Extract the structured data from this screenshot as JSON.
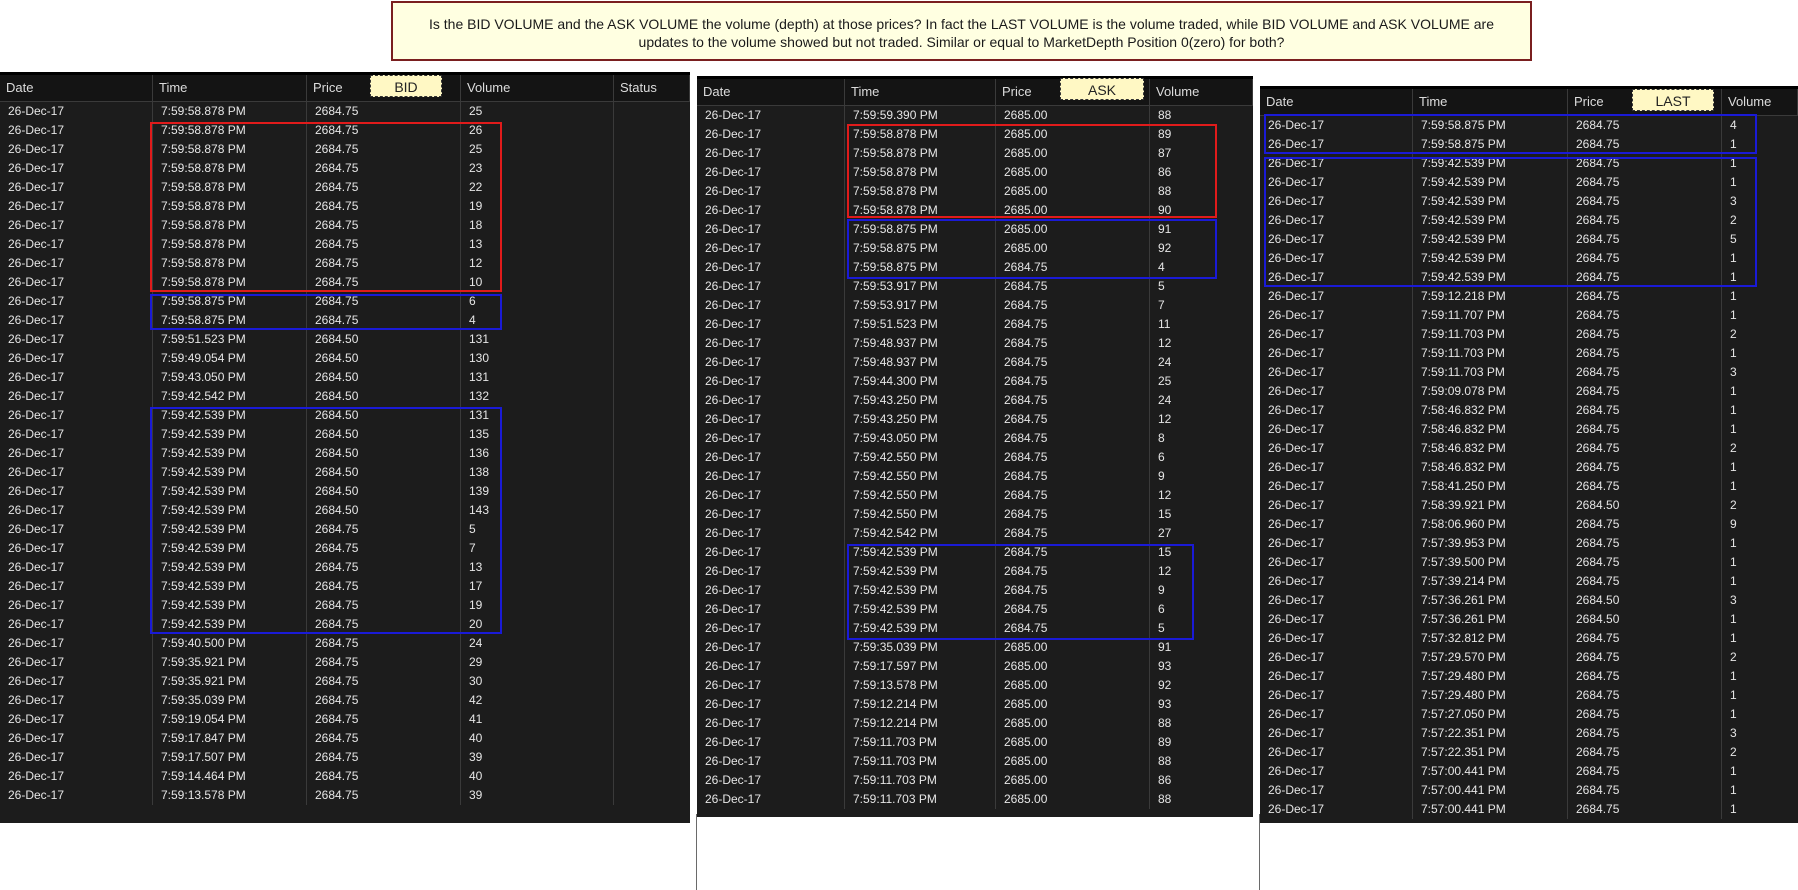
{
  "note": {
    "text": "Is the BID VOLUME and the ASK VOLUME the volume (depth) at those prices? In fact the LAST VOLUME is the volume traded, while BID VOLUME and ASK VOLUME are updates to the volume showed but not traded. Similar or equal to MarketDepth Position 0(zero) for both?"
  },
  "bid": {
    "tag": "BID",
    "headers": [
      "Date",
      "Time",
      "Price",
      "Volume",
      "Status"
    ],
    "rows": [
      [
        "26-Dec-17",
        "7:59:58.878 PM",
        "2684.75",
        "25"
      ],
      [
        "26-Dec-17",
        "7:59:58.878 PM",
        "2684.75",
        "26"
      ],
      [
        "26-Dec-17",
        "7:59:58.878 PM",
        "2684.75",
        "25"
      ],
      [
        "26-Dec-17",
        "7:59:58.878 PM",
        "2684.75",
        "23"
      ],
      [
        "26-Dec-17",
        "7:59:58.878 PM",
        "2684.75",
        "22"
      ],
      [
        "26-Dec-17",
        "7:59:58.878 PM",
        "2684.75",
        "19"
      ],
      [
        "26-Dec-17",
        "7:59:58.878 PM",
        "2684.75",
        "18"
      ],
      [
        "26-Dec-17",
        "7:59:58.878 PM",
        "2684.75",
        "13"
      ],
      [
        "26-Dec-17",
        "7:59:58.878 PM",
        "2684.75",
        "12"
      ],
      [
        "26-Dec-17",
        "7:59:58.878 PM",
        "2684.75",
        "10"
      ],
      [
        "26-Dec-17",
        "7:59:58.875 PM",
        "2684.75",
        "6"
      ],
      [
        "26-Dec-17",
        "7:59:58.875 PM",
        "2684.75",
        "4"
      ],
      [
        "26-Dec-17",
        "7:59:51.523 PM",
        "2684.50",
        "131"
      ],
      [
        "26-Dec-17",
        "7:59:49.054 PM",
        "2684.50",
        "130"
      ],
      [
        "26-Dec-17",
        "7:59:43.050 PM",
        "2684.50",
        "131"
      ],
      [
        "26-Dec-17",
        "7:59:42.542 PM",
        "2684.50",
        "132"
      ],
      [
        "26-Dec-17",
        "7:59:42.539 PM",
        "2684.50",
        "131"
      ],
      [
        "26-Dec-17",
        "7:59:42.539 PM",
        "2684.50",
        "135"
      ],
      [
        "26-Dec-17",
        "7:59:42.539 PM",
        "2684.50",
        "136"
      ],
      [
        "26-Dec-17",
        "7:59:42.539 PM",
        "2684.50",
        "138"
      ],
      [
        "26-Dec-17",
        "7:59:42.539 PM",
        "2684.50",
        "139"
      ],
      [
        "26-Dec-17",
        "7:59:42.539 PM",
        "2684.50",
        "143"
      ],
      [
        "26-Dec-17",
        "7:59:42.539 PM",
        "2684.75",
        "5"
      ],
      [
        "26-Dec-17",
        "7:59:42.539 PM",
        "2684.75",
        "7"
      ],
      [
        "26-Dec-17",
        "7:59:42.539 PM",
        "2684.75",
        "13"
      ],
      [
        "26-Dec-17",
        "7:59:42.539 PM",
        "2684.75",
        "17"
      ],
      [
        "26-Dec-17",
        "7:59:42.539 PM",
        "2684.75",
        "19"
      ],
      [
        "26-Dec-17",
        "7:59:42.539 PM",
        "2684.75",
        "20"
      ],
      [
        "26-Dec-17",
        "7:59:40.500 PM",
        "2684.75",
        "24"
      ],
      [
        "26-Dec-17",
        "7:59:35.921 PM",
        "2684.75",
        "29"
      ],
      [
        "26-Dec-17",
        "7:59:35.921 PM",
        "2684.75",
        "30"
      ],
      [
        "26-Dec-17",
        "7:59:35.039 PM",
        "2684.75",
        "42"
      ],
      [
        "26-Dec-17",
        "7:59:19.054 PM",
        "2684.75",
        "41"
      ],
      [
        "26-Dec-17",
        "7:59:17.847 PM",
        "2684.75",
        "40"
      ],
      [
        "26-Dec-17",
        "7:59:17.507 PM",
        "2684.75",
        "39"
      ],
      [
        "26-Dec-17",
        "7:59:14.464 PM",
        "2684.75",
        "40"
      ],
      [
        "26-Dec-17",
        "7:59:13.578 PM",
        "2684.75",
        "39"
      ]
    ]
  },
  "ask": {
    "tag": "ASK",
    "headers": [
      "Date",
      "Time",
      "Price",
      "Volume"
    ],
    "rows": [
      [
        "26-Dec-17",
        "7:59:59.390 PM",
        "2685.00",
        "88"
      ],
      [
        "26-Dec-17",
        "7:59:58.878 PM",
        "2685.00",
        "89"
      ],
      [
        "26-Dec-17",
        "7:59:58.878 PM",
        "2685.00",
        "87"
      ],
      [
        "26-Dec-17",
        "7:59:58.878 PM",
        "2685.00",
        "86"
      ],
      [
        "26-Dec-17",
        "7:59:58.878 PM",
        "2685.00",
        "88"
      ],
      [
        "26-Dec-17",
        "7:59:58.878 PM",
        "2685.00",
        "90"
      ],
      [
        "26-Dec-17",
        "7:59:58.875 PM",
        "2685.00",
        "91"
      ],
      [
        "26-Dec-17",
        "7:59:58.875 PM",
        "2685.00",
        "92"
      ],
      [
        "26-Dec-17",
        "7:59:58.875 PM",
        "2684.75",
        "4"
      ],
      [
        "26-Dec-17",
        "7:59:53.917 PM",
        "2684.75",
        "5"
      ],
      [
        "26-Dec-17",
        "7:59:53.917 PM",
        "2684.75",
        "7"
      ],
      [
        "26-Dec-17",
        "7:59:51.523 PM",
        "2684.75",
        "11"
      ],
      [
        "26-Dec-17",
        "7:59:48.937 PM",
        "2684.75",
        "12"
      ],
      [
        "26-Dec-17",
        "7:59:48.937 PM",
        "2684.75",
        "24"
      ],
      [
        "26-Dec-17",
        "7:59:44.300 PM",
        "2684.75",
        "25"
      ],
      [
        "26-Dec-17",
        "7:59:43.250 PM",
        "2684.75",
        "24"
      ],
      [
        "26-Dec-17",
        "7:59:43.250 PM",
        "2684.75",
        "12"
      ],
      [
        "26-Dec-17",
        "7:59:43.050 PM",
        "2684.75",
        "8"
      ],
      [
        "26-Dec-17",
        "7:59:42.550 PM",
        "2684.75",
        "6"
      ],
      [
        "26-Dec-17",
        "7:59:42.550 PM",
        "2684.75",
        "9"
      ],
      [
        "26-Dec-17",
        "7:59:42.550 PM",
        "2684.75",
        "12"
      ],
      [
        "26-Dec-17",
        "7:59:42.550 PM",
        "2684.75",
        "15"
      ],
      [
        "26-Dec-17",
        "7:59:42.542 PM",
        "2684.75",
        "27"
      ],
      [
        "26-Dec-17",
        "7:59:42.539 PM",
        "2684.75",
        "15"
      ],
      [
        "26-Dec-17",
        "7:59:42.539 PM",
        "2684.75",
        "12"
      ],
      [
        "26-Dec-17",
        "7:59:42.539 PM",
        "2684.75",
        "9"
      ],
      [
        "26-Dec-17",
        "7:59:42.539 PM",
        "2684.75",
        "6"
      ],
      [
        "26-Dec-17",
        "7:59:42.539 PM",
        "2684.75",
        "5"
      ],
      [
        "26-Dec-17",
        "7:59:35.039 PM",
        "2685.00",
        "91"
      ],
      [
        "26-Dec-17",
        "7:59:17.597 PM",
        "2685.00",
        "93"
      ],
      [
        "26-Dec-17",
        "7:59:13.578 PM",
        "2685.00",
        "92"
      ],
      [
        "26-Dec-17",
        "7:59:12.214 PM",
        "2685.00",
        "93"
      ],
      [
        "26-Dec-17",
        "7:59:12.214 PM",
        "2685.00",
        "88"
      ],
      [
        "26-Dec-17",
        "7:59:11.703 PM",
        "2685.00",
        "89"
      ],
      [
        "26-Dec-17",
        "7:59:11.703 PM",
        "2685.00",
        "88"
      ],
      [
        "26-Dec-17",
        "7:59:11.703 PM",
        "2685.00",
        "86"
      ],
      [
        "26-Dec-17",
        "7:59:11.703 PM",
        "2685.00",
        "88"
      ]
    ]
  },
  "last": {
    "tag": "LAST",
    "headers": [
      "Date",
      "Time",
      "Price",
      "Volume"
    ],
    "rows": [
      [
        "26-Dec-17",
        "7:59:58.875 PM",
        "2684.75",
        "4"
      ],
      [
        "26-Dec-17",
        "7:59:58.875 PM",
        "2684.75",
        "1"
      ],
      [
        "26-Dec-17",
        "7:59:42.539 PM",
        "2684.75",
        "1"
      ],
      [
        "26-Dec-17",
        "7:59:42.539 PM",
        "2684.75",
        "1"
      ],
      [
        "26-Dec-17",
        "7:59:42.539 PM",
        "2684.75",
        "3"
      ],
      [
        "26-Dec-17",
        "7:59:42.539 PM",
        "2684.75",
        "2"
      ],
      [
        "26-Dec-17",
        "7:59:42.539 PM",
        "2684.75",
        "5"
      ],
      [
        "26-Dec-17",
        "7:59:42.539 PM",
        "2684.75",
        "1"
      ],
      [
        "26-Dec-17",
        "7:59:42.539 PM",
        "2684.75",
        "1"
      ],
      [
        "26-Dec-17",
        "7:59:12.218 PM",
        "2684.75",
        "1"
      ],
      [
        "26-Dec-17",
        "7:59:11.707 PM",
        "2684.75",
        "1"
      ],
      [
        "26-Dec-17",
        "7:59:11.703 PM",
        "2684.75",
        "2"
      ],
      [
        "26-Dec-17",
        "7:59:11.703 PM",
        "2684.75",
        "1"
      ],
      [
        "26-Dec-17",
        "7:59:11.703 PM",
        "2684.75",
        "3"
      ],
      [
        "26-Dec-17",
        "7:59:09.078 PM",
        "2684.75",
        "1"
      ],
      [
        "26-Dec-17",
        "7:58:46.832 PM",
        "2684.75",
        "1"
      ],
      [
        "26-Dec-17",
        "7:58:46.832 PM",
        "2684.75",
        "1"
      ],
      [
        "26-Dec-17",
        "7:58:46.832 PM",
        "2684.75",
        "2"
      ],
      [
        "26-Dec-17",
        "7:58:46.832 PM",
        "2684.75",
        "1"
      ],
      [
        "26-Dec-17",
        "7:58:41.250 PM",
        "2684.75",
        "1"
      ],
      [
        "26-Dec-17",
        "7:58:39.921 PM",
        "2684.50",
        "2"
      ],
      [
        "26-Dec-17",
        "7:58:06.960 PM",
        "2684.75",
        "9"
      ],
      [
        "26-Dec-17",
        "7:57:39.953 PM",
        "2684.75",
        "1"
      ],
      [
        "26-Dec-17",
        "7:57:39.500 PM",
        "2684.75",
        "1"
      ],
      [
        "26-Dec-17",
        "7:57:39.214 PM",
        "2684.75",
        "1"
      ],
      [
        "26-Dec-17",
        "7:57:36.261 PM",
        "2684.50",
        "3"
      ],
      [
        "26-Dec-17",
        "7:57:36.261 PM",
        "2684.50",
        "1"
      ],
      [
        "26-Dec-17",
        "7:57:32.812 PM",
        "2684.75",
        "1"
      ],
      [
        "26-Dec-17",
        "7:57:29.570 PM",
        "2684.75",
        "2"
      ],
      [
        "26-Dec-17",
        "7:57:29.480 PM",
        "2684.75",
        "1"
      ],
      [
        "26-Dec-17",
        "7:57:29.480 PM",
        "2684.75",
        "1"
      ],
      [
        "26-Dec-17",
        "7:57:27.050 PM",
        "2684.75",
        "1"
      ],
      [
        "26-Dec-17",
        "7:57:22.351 PM",
        "2684.75",
        "3"
      ],
      [
        "26-Dec-17",
        "7:57:22.351 PM",
        "2684.75",
        "2"
      ],
      [
        "26-Dec-17",
        "7:57:00.441 PM",
        "2684.75",
        "1"
      ],
      [
        "26-Dec-17",
        "7:57:00.441 PM",
        "2684.75",
        "1"
      ],
      [
        "26-Dec-17",
        "7:57:00.441 PM",
        "2684.75",
        "1"
      ]
    ]
  },
  "colors": {
    "highlight_red": "#e01b1b",
    "highlight_blue": "#1a1ad6",
    "note_bg": "#ffffe1",
    "tag_bg": "#fff8c4"
  }
}
